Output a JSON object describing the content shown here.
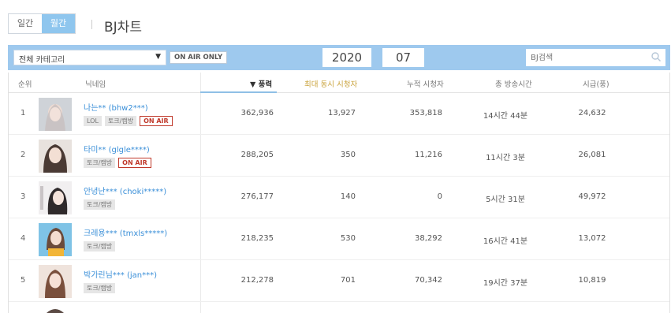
{
  "header": {
    "period_daily": "일간",
    "period_monthly": "월간",
    "title": "BJ차트"
  },
  "filters": {
    "category": "전체 카테고리",
    "onair_only": "ON AIR ONLY",
    "year": "2020",
    "month": "07",
    "search_placeholder": "BJ검색"
  },
  "columns": {
    "rank": "순위",
    "nickname": "닉네임",
    "power": "▼ 풍력",
    "max_viewers": "최대 동시 시청자",
    "total_viewers": "누적 시청자",
    "total_broadcast": "총 방송시간",
    "hourly": "시급(풍)"
  },
  "colors": {
    "accent": "#9ec9ee",
    "link": "#3a8fd8",
    "onair": "#c0392b",
    "gold": "#c9a23a"
  },
  "rows": [
    {
      "rank": "1",
      "name": "나는**",
      "id": "(bhw2***)",
      "tags": [
        "LOL",
        "토크/캠방"
      ],
      "onair": "ON AIR",
      "power": "362,936",
      "max": "13,927",
      "total": "353,818",
      "time": "14시간 44분",
      "hourly": "24,632"
    },
    {
      "rank": "2",
      "name": "타미**",
      "id": "(glgle****)",
      "tags": [
        "토크/캠방"
      ],
      "onair": "ON AIR",
      "power": "288,205",
      "max": "350",
      "total": "11,216",
      "time": "11시간 3분",
      "hourly": "26,081"
    },
    {
      "rank": "3",
      "name": "안녕난***",
      "id": "(choki*****)",
      "tags": [
        "토크/캠방"
      ],
      "onair": "",
      "power": "276,177",
      "max": "140",
      "total": "0",
      "time": "5시간 31분",
      "hourly": "49,972"
    },
    {
      "rank": "4",
      "name": "크레용***",
      "id": "(tmxls*****)",
      "tags": [
        "토크/캠방"
      ],
      "onair": "",
      "power": "218,235",
      "max": "530",
      "total": "38,292",
      "time": "16시간 41분",
      "hourly": "13,072"
    },
    {
      "rank": "5",
      "name": "박가린님***",
      "id": "(jan***)",
      "tags": [
        "토크/캠방"
      ],
      "onair": "",
      "power": "212,278",
      "max": "701",
      "total": "70,342",
      "time": "19시간 37분",
      "hourly": "10,819"
    }
  ]
}
